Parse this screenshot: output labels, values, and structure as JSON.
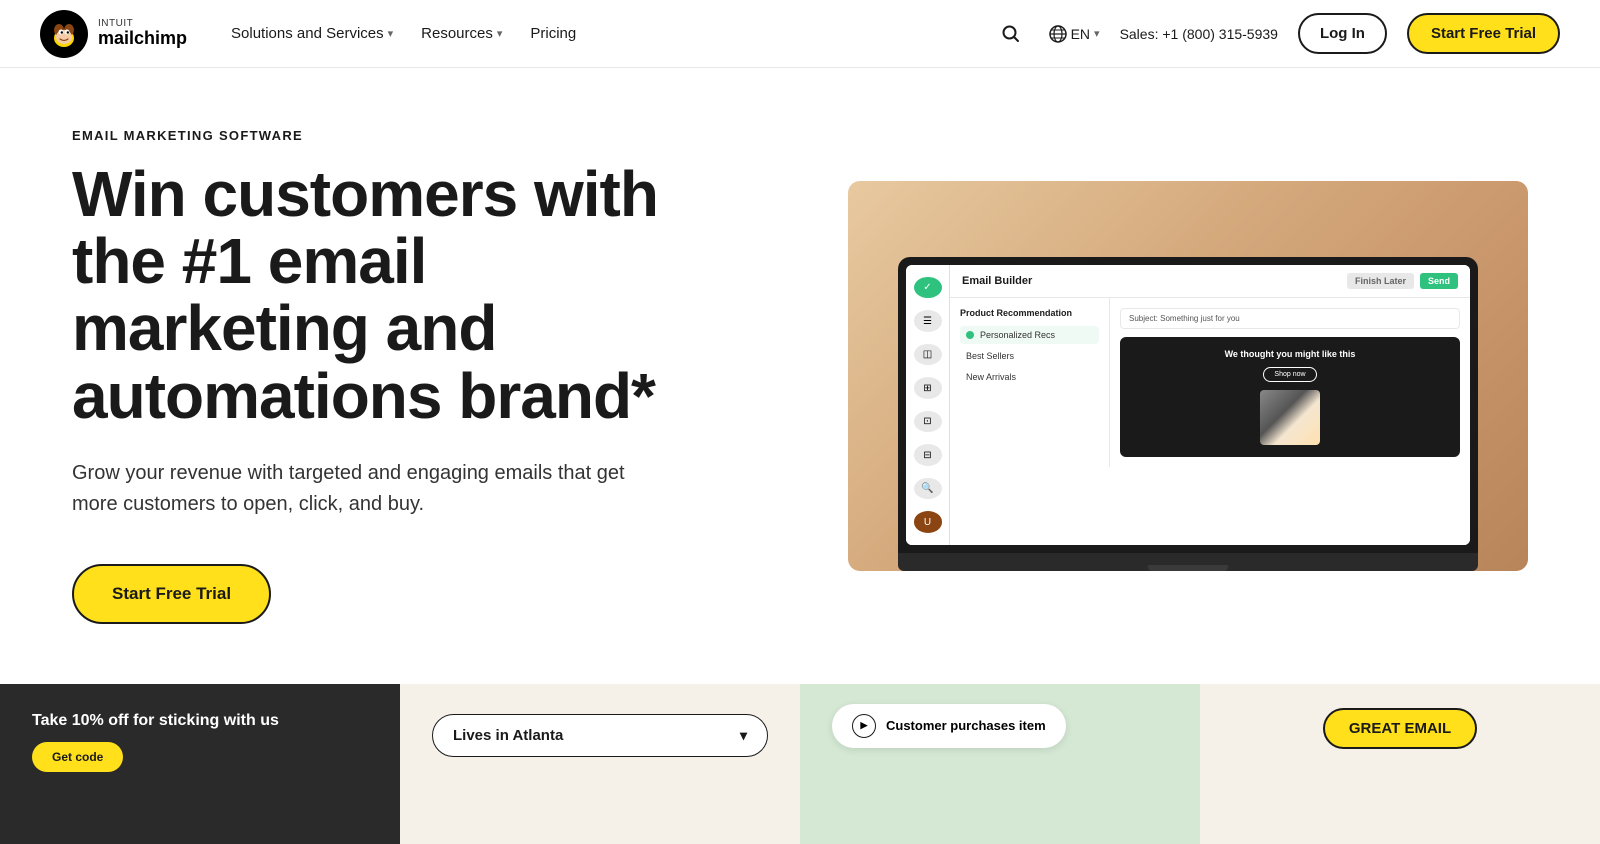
{
  "brand": {
    "intuit_label": "INTUIT",
    "name": "mailchimp"
  },
  "nav": {
    "solutions_label": "Solutions and Services",
    "resources_label": "Resources",
    "pricing_label": "Pricing",
    "search_placeholder": "Search",
    "lang_label": "EN",
    "sales_text": "Sales: +1 (800) 315-5939",
    "login_label": "Log In",
    "trial_label": "Start Free Trial"
  },
  "hero": {
    "eyebrow": "EMAIL MARKETING SOFTWARE",
    "title": "Win customers with the #1 email marketing and automations brand*",
    "description": "Grow your revenue with targeted and engaging emails that get more customers to open, click, and buy.",
    "cta_label": "Start Free Trial"
  },
  "email_builder": {
    "title": "Email Builder",
    "btn_finish": "Finish Later",
    "btn_send": "Send",
    "panel_title": "Product Recommendation",
    "subject_label": "Subject: Something just for you",
    "items": [
      {
        "label": "Personalized Recs",
        "active": true
      },
      {
        "label": "Best Sellers",
        "active": false
      },
      {
        "label": "New Arrivals",
        "active": false
      }
    ],
    "email_card_title": "We thought you might like this",
    "shop_btn": "Shop now"
  },
  "bottom_cards": {
    "card1_promo": "Take 10% off for sticking with us",
    "card1_btn": "Get code",
    "card2_dropdown": "Lives in Atlanta",
    "card3_trigger": "Customer purchases item",
    "card4_badge": "GREAT EMAIL"
  }
}
